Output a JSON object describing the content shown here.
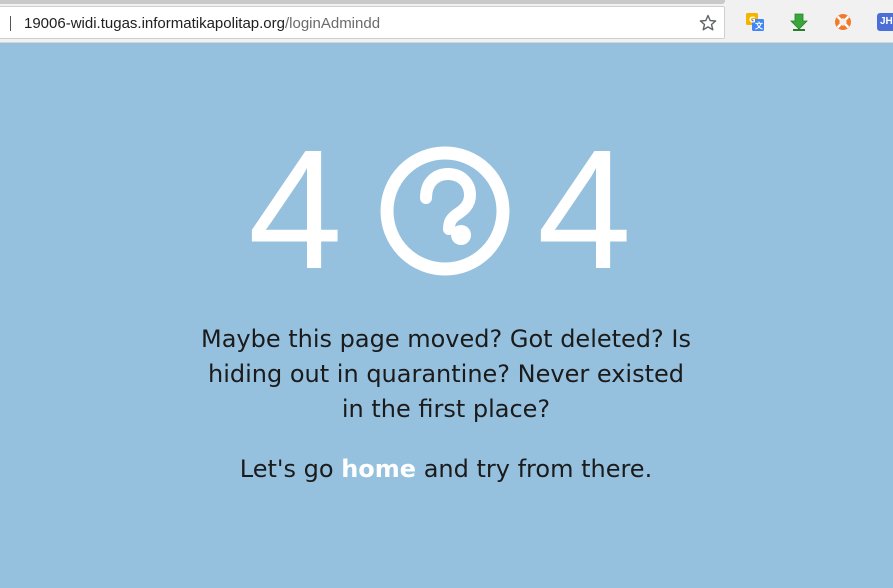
{
  "browser": {
    "url_host": "19006-widi.tugas.informatikapolitap.org",
    "url_path": "/loginAdmindd",
    "extensions": {
      "translate_icon": "translate-icon",
      "download_icon": "download-arrow-icon",
      "lifebuoy_icon": "lifebuoy-icon",
      "jh_label": "JH"
    }
  },
  "error_page": {
    "digit_left": "4",
    "digit_right": "4",
    "center_icon": "question-circle-icon",
    "message": "Maybe this page moved? Got deleted? Is hiding out in quarantine? Never existed in the first place?",
    "cta_prefix": "Let's go",
    "cta_link": "home",
    "cta_suffix": "and try from there."
  },
  "colors": {
    "background": "#95c1df",
    "foreground_graphic": "#ffffff",
    "text": "#1b1b1b",
    "link": "#ffffff"
  }
}
